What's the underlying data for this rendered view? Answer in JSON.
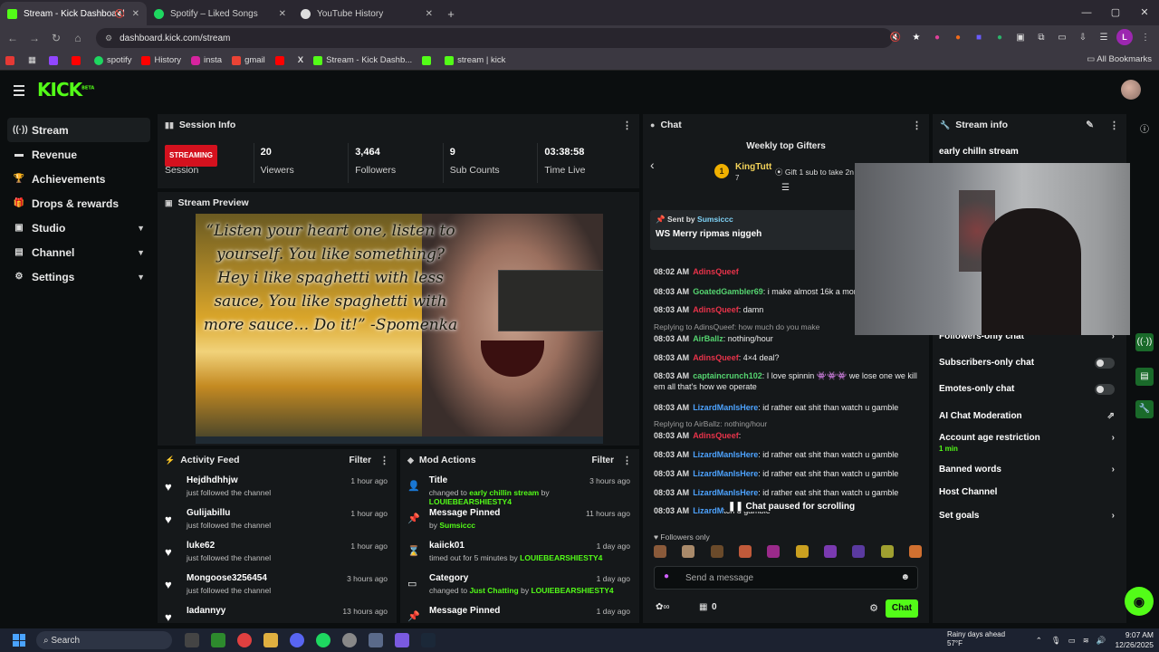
{
  "browser": {
    "tabs": [
      {
        "title": "Stream - Kick Dashboard",
        "color": "#53fc18",
        "active": true
      },
      {
        "title": "Spotify – Liked Songs",
        "color": "#1ed760",
        "active": false
      },
      {
        "title": "YouTube History",
        "color": "#ff0000",
        "active": false
      }
    ],
    "url": "dashboard.kick.com/stream",
    "bookmarks": [
      "spotify",
      "History",
      "insta",
      "gmail",
      "X",
      "Stream - Kick Dashb...",
      "stream | kick"
    ],
    "all_bookmarks": "All Bookmarks",
    "profile_letter": "L"
  },
  "header": {
    "logo": "KICK",
    "logo_sup": "BETA"
  },
  "sidebar": {
    "items": [
      {
        "label": "Stream",
        "icon": "broadcast-icon",
        "glyph": "((·))",
        "active": true,
        "chevron": false
      },
      {
        "label": "Revenue",
        "icon": "revenue-icon",
        "glyph": "▬",
        "active": false,
        "chevron": false
      },
      {
        "label": "Achievements",
        "icon": "trophy-icon",
        "glyph": "🏆",
        "active": false,
        "chevron": false
      },
      {
        "label": "Drops & rewards",
        "icon": "gift-icon",
        "glyph": "🎁",
        "active": false,
        "chevron": false
      },
      {
        "label": "Studio",
        "icon": "studio-icon",
        "glyph": "▣",
        "active": false,
        "chevron": true
      },
      {
        "label": "Channel",
        "icon": "channel-icon",
        "glyph": "▤",
        "active": false,
        "chevron": true
      },
      {
        "label": "Settings",
        "icon": "gear-icon",
        "glyph": "⚙",
        "active": false,
        "chevron": true
      }
    ]
  },
  "session": {
    "title": "Session Info",
    "status": "STREAMING",
    "stats": [
      {
        "value": "",
        "label": "Session"
      },
      {
        "value": "20",
        "label": "Viewers"
      },
      {
        "value": "3,464",
        "label": "Followers"
      },
      {
        "value": "9",
        "label": "Sub Counts"
      },
      {
        "value": "03:38:58",
        "label": "Time Live"
      }
    ]
  },
  "preview": {
    "title": "Stream Preview",
    "quote": "“Listen your heart one, listen to yourself. You like something? Hey i like spaghetti with less sauce, You like spaghetti with more sauce… Do it!” -Spomenka"
  },
  "activity": {
    "title": "Activity Feed",
    "filter": "Filter",
    "items": [
      {
        "name": "Hejdhdhhjw",
        "sub": "just followed the channel",
        "time": "1 hour ago"
      },
      {
        "name": "Gulijabillu",
        "sub": "just followed the channel",
        "time": "1 hour ago"
      },
      {
        "name": "luke62",
        "sub": "just followed the channel",
        "time": "1 hour ago"
      },
      {
        "name": "Mongoose3256454",
        "sub": "just followed the channel",
        "time": "3 hours ago"
      },
      {
        "name": "Iadannyy",
        "sub": "",
        "time": "13 hours ago"
      }
    ]
  },
  "mod": {
    "title": "Mod Actions",
    "filter": "Filter",
    "items": [
      {
        "icon": "user-edit-icon",
        "glyph": "👤",
        "name": "Title",
        "pre": "changed to ",
        "mid": "early chillin stream",
        "by": " by ",
        "who": "LOUIEBEARSHIESTY4",
        "time": "3 hours ago"
      },
      {
        "icon": "pin-icon",
        "glyph": "📌",
        "name": "Message Pinned",
        "pre": "by ",
        "mid": "",
        "by": "",
        "who": "Sumsiccc",
        "time": "11 hours ago"
      },
      {
        "icon": "hourglass-icon",
        "glyph": "⌛",
        "name": "kaiick01",
        "pre": "timed out for 5 minutes",
        "mid": "",
        "by": " by ",
        "who": "LOUIEBEARSHIESTY4",
        "time": "1 day ago"
      },
      {
        "icon": "category-icon",
        "glyph": "▭",
        "name": "Category",
        "pre": "changed to ",
        "mid": "Just Chatting",
        "by": " by ",
        "who": "LOUIEBEARSHIESTY4",
        "time": "1 day ago"
      },
      {
        "icon": "pin-icon",
        "glyph": "📌",
        "name": "Message Pinned",
        "pre": "",
        "mid": "",
        "by": "",
        "who": "",
        "time": "1 day ago"
      }
    ]
  },
  "chat": {
    "title": "Chat",
    "gifters_title": "Weekly top Gifters",
    "gifter_rank": "1",
    "gifter_name": "KingTutt",
    "gifter_count": "7",
    "gifter_note": "Gift 1 sub to take 2n",
    "pinned_by_label": "Sent by",
    "pinned_by": "Sumsiccc",
    "pinned_msg": "WS Merry ripmas niggeh",
    "messages": [
      {
        "time": "08:02 AM",
        "user": "AdinsQueef",
        "color": "red",
        "text": ""
      },
      {
        "time": "08:03 AM",
        "user": "GoatedGambler69",
        "color": "grn",
        "text": ": i make almost 16k a mon"
      },
      {
        "time": "08:03 AM",
        "user": "AdinsQueef",
        "color": "red",
        "text": ": damn"
      },
      {
        "time": "08:03 AM",
        "user": "AirBallz",
        "color": "grn",
        "text": ": nothing/hour"
      },
      {
        "time": "08:03 AM",
        "user": "AdinsQueef",
        "color": "red",
        "text": ": 4×4 deal?"
      },
      {
        "time": "08:03 AM",
        "user": "captaincrunch102",
        "color": "grn",
        "text": ": I love spinnin 👾👾👾 we lose one we kill em all that's how we operate"
      },
      {
        "time": "08:03 AM",
        "user": "LizardManIsHere",
        "color": "blu",
        "text": ": id rather eat shit than watch u gamble"
      },
      {
        "time": "08:03 AM",
        "user": "AdinsQueef",
        "color": "red",
        "text": ":"
      },
      {
        "time": "08:03 AM",
        "user": "LizardManIsHere",
        "color": "blu",
        "text": ": id rather eat shit than watch u gamble"
      },
      {
        "time": "08:03 AM",
        "user": "LizardManIsHere",
        "color": "blu",
        "text": ": id rather eat shit than watch u gamble"
      },
      {
        "time": "08:03 AM",
        "user": "LizardManIsHere",
        "color": "blu",
        "text": ": id rather eat shit than watch u gamble"
      },
      {
        "time": "08:03 AM",
        "user": "LizardM",
        "color": "blu",
        "text": "tch u gamble"
      }
    ],
    "reply1": "Replying to AdinsQueef: how much do you make",
    "reply2": "Replying to AirBallz: nothing/hour",
    "paused": "Chat paused for scrolling",
    "followers_only": "Followers only",
    "placeholder": "Send a message",
    "points": "0",
    "send": "Chat"
  },
  "streaminfo": {
    "title": "Stream info",
    "stream_title": "early chilln stream",
    "rows": [
      {
        "label": "Followers-only chat",
        "control": "chevron"
      },
      {
        "label": "Subscribers-only chat",
        "control": "toggle"
      },
      {
        "label": "Emotes-only chat",
        "control": "toggle"
      },
      {
        "label": "AI Chat Moderation",
        "control": "external"
      },
      {
        "label": "Account age restriction",
        "control": "chevron",
        "sub": "1 min"
      },
      {
        "label": "Banned words",
        "control": "chevron"
      },
      {
        "label": "Host Channel",
        "control": "none"
      },
      {
        "label": "Set goals",
        "control": "chevron"
      }
    ]
  },
  "taskbar": {
    "search": "Search",
    "weather_title": "Rainy days ahead",
    "weather_temp": "57°F",
    "time": "9:07 AM",
    "date": "12/26/2025"
  },
  "colors": {
    "accent": "#53fc18",
    "live": "#d4111e",
    "panel": "#15181a",
    "bg": "#0b0e0f"
  }
}
